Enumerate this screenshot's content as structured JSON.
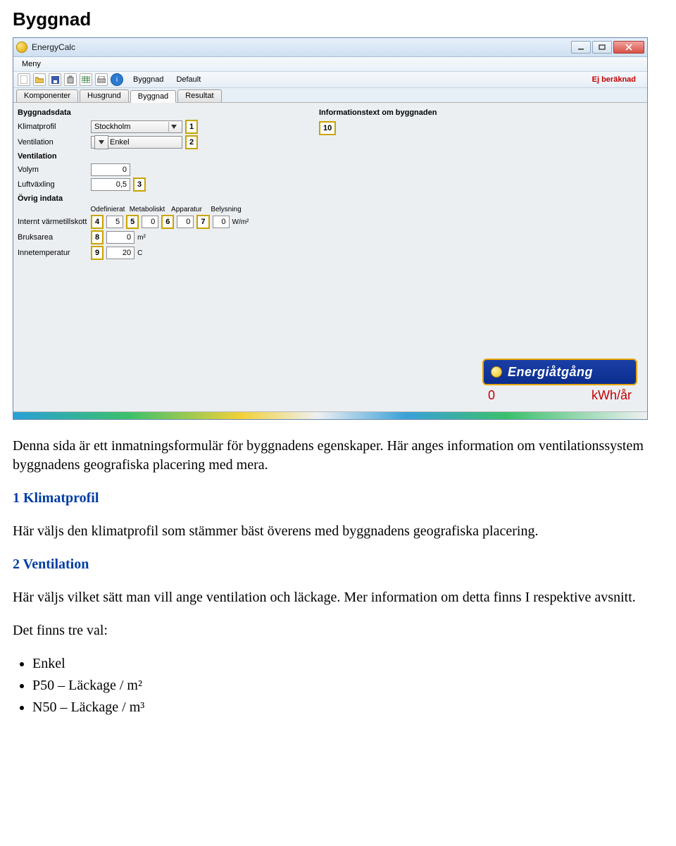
{
  "doc": {
    "title": "Byggnad",
    "intro": "Denna sida är ett inmatningsformulär för byggnadens egenskaper. Här anges information om ventilationssystem byggnadens geografiska placering med mera.",
    "sections": [
      {
        "h": "1 Klimatprofil",
        "p": "Här väljs den klimatprofil som stämmer bäst överens med byggnadens geografiska placering."
      },
      {
        "h": "2 Ventilation",
        "p": "Här väljs vilket sätt man vill ange ventilation och läckage. Mer information om detta finns I respektive avsnitt."
      }
    ],
    "list_intro": "Det finns tre val:",
    "list": [
      "Enkel",
      "P50 – Läckage / m²",
      "N50 – Läckage / m³"
    ]
  },
  "app": {
    "title": "EnergyCalc",
    "menu": "Meny",
    "status": "Ej beräknad",
    "breadcrumb1": "Byggnad",
    "breadcrumb2": "Default",
    "tabs": [
      "Komponenter",
      "Husgrund",
      "Byggnad",
      "Resultat"
    ],
    "active_tab": 2
  },
  "left": {
    "heading1": "Byggnadsdata",
    "klimat_label": "Klimatprofil",
    "klimat_value": "Stockholm",
    "vent_label": "Ventilation",
    "vent_value": "Enkel",
    "heading2": "Ventilation",
    "volym_label": "Volym",
    "volym_value": "0",
    "luft_label": "Luftväxling",
    "luft_value": "0,5",
    "heading3": "Övrig indata",
    "intheat_label": "Internt värmetillskott",
    "col_odef": "Odefinierat",
    "col_metab": "Metaboliskt",
    "col_app": "Apparatur",
    "col_bel": "Belysning",
    "v_odef": "5",
    "v_metab": "0",
    "v_app": "0",
    "v_bel": "0",
    "wm2": "W/m²",
    "area_label": "Bruksarea",
    "area_value": "0",
    "area_unit": "m²",
    "temp_label": "Innetemperatur",
    "temp_value": "20",
    "temp_unit": "C"
  },
  "right": {
    "heading": "Informationstext om byggnaden"
  },
  "markers": {
    "m1": "1",
    "m2": "2",
    "m3": "3",
    "m4": "4",
    "m5": "5",
    "m6": "6",
    "m7": "7",
    "m8": "8",
    "m9": "9",
    "m10": "10"
  },
  "energy": {
    "btn": "Energiåtgång",
    "value": "0",
    "unit": "kWh/år"
  }
}
